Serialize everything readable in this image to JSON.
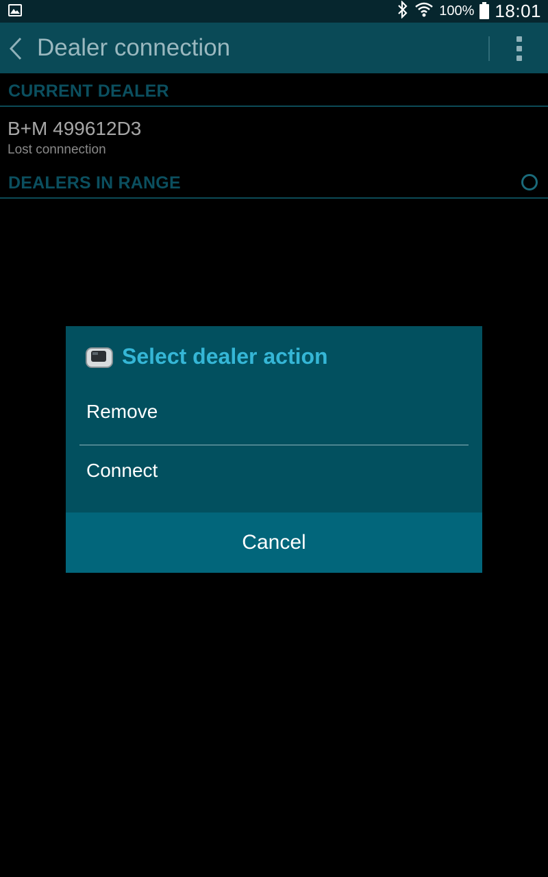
{
  "status_bar": {
    "battery_percent": "100%",
    "time": "18:01",
    "icons": [
      "gallery-icon",
      "bluetooth-icon",
      "wifi-icon",
      "battery-icon"
    ]
  },
  "action_bar": {
    "title": "Dealer connection",
    "back_icon": "chevron-left-icon",
    "overflow_icon": "overflow-menu-icon"
  },
  "current_dealer": {
    "header": "CURRENT DEALER",
    "name": "B+M 499612D3",
    "status": "Lost connnection"
  },
  "dealers_in_range": {
    "header": "DEALERS IN RANGE",
    "refresh_icon": "refresh-icon"
  },
  "dialog": {
    "title": "Select dealer action",
    "icon": "dealer-device-icon",
    "items": [
      "Remove",
      "Connect"
    ],
    "cancel_label": "Cancel"
  },
  "colors": {
    "action_bar_bg": "#0a4a57",
    "dialog_bg": "#02505f",
    "dialog_button_bg": "#02667b",
    "accent": "#35b6d6",
    "section_header": "#0b4f5f"
  }
}
